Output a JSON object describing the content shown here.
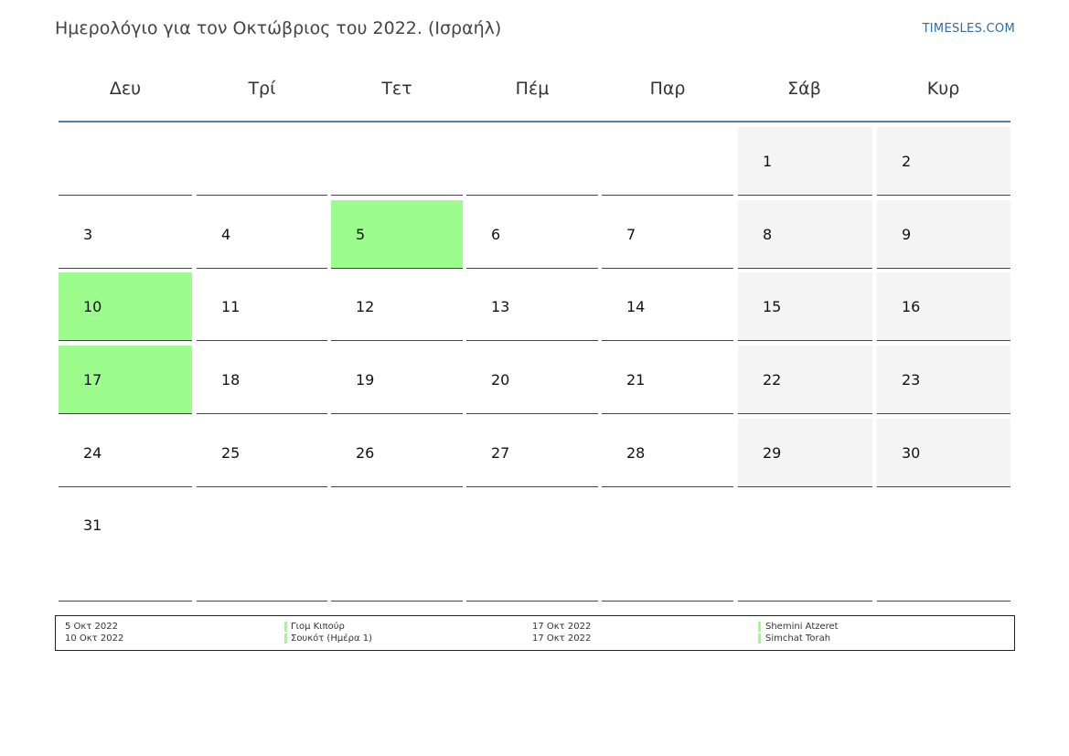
{
  "header": {
    "title": "Ημερολόγιο για τον Οκτώβριος του 2022. (Ισραήλ)",
    "brand": "TIMESLES.COM"
  },
  "colors": {
    "holiday": "#9cfc8c",
    "weekend": "#f4f4f4",
    "header_rule": "#5a7a9e",
    "brand": "#2e6da4"
  },
  "weekdays": [
    "Δευ",
    "Τρί",
    "Τετ",
    "Πέμ",
    "Παρ",
    "Σάβ",
    "Κυρ"
  ],
  "weeks": [
    [
      "",
      "",
      "",
      "",
      "",
      "1",
      "2"
    ],
    [
      "3",
      "4",
      "5",
      "6",
      "7",
      "8",
      "9"
    ],
    [
      "10",
      "11",
      "12",
      "13",
      "14",
      "15",
      "16"
    ],
    [
      "17",
      "18",
      "19",
      "20",
      "21",
      "22",
      "23"
    ],
    [
      "24",
      "25",
      "26",
      "27",
      "28",
      "29",
      "30"
    ],
    [
      "31",
      "",
      "",
      "",
      "",
      "",
      ""
    ]
  ],
  "holiday_days": [
    "5",
    "10",
    "17"
  ],
  "legend": [
    {
      "date": "5 Οκτ 2022",
      "name": "Γιομ Κιπούρ"
    },
    {
      "date": "10 Οκτ 2022",
      "name": "Σουκότ (Ημέρα 1)"
    },
    {
      "date": "17 Οκτ 2022",
      "name": "Shemini Atzeret"
    },
    {
      "date": "17 Οκτ 2022",
      "name": "Simchat Torah"
    }
  ]
}
